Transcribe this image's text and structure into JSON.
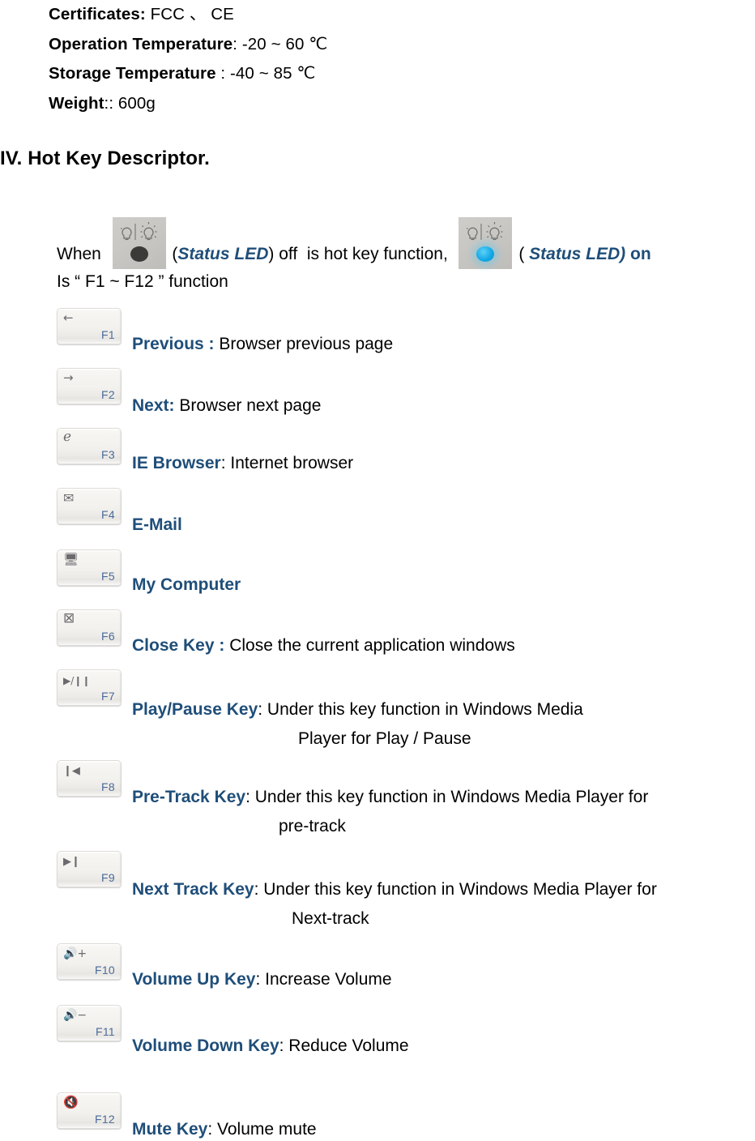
{
  "specs": [
    {
      "label": "Certificates:",
      "value": "  FCC  、  CE"
    },
    {
      "label": "Operation Temperature",
      "value": ": -20 ~ 60 ℃"
    },
    {
      "label": "Storage Temperature",
      "value": " : -40 ~ 85 ℃"
    },
    {
      "label": "Weight",
      "value": ":: 600g"
    }
  ],
  "section": {
    "heading": "IV. Hot Key Descriptor",
    "heading_tail": "."
  },
  "intro": {
    "when": "When",
    "led_off_paren_open": "(",
    "led_off_name": "Status LED",
    "led_off_paren_close": ") off",
    "mid": "is hot key function,",
    "led_on_paren_open": "(",
    "led_on_name": " Status LED)",
    "led_on_state": " on",
    "second_line": "Is  “ F1 ~ F12 ”  function",
    "led_off_icon": "status-led-off-icon",
    "led_on_icon": "status-led-on-icon"
  },
  "hotkeys": [
    {
      "key": "F1",
      "glyph": "←",
      "glyph_name": "arrow-left-icon",
      "label": "Previous :",
      "desc": " Browser previous page",
      "cont": null
    },
    {
      "key": "F2",
      "glyph": "→",
      "glyph_name": "arrow-right-icon",
      "label": "Next:",
      "desc": " Browser next page",
      "cont": null
    },
    {
      "key": "F3",
      "glyph": "ℯ",
      "glyph_name": "internet-explorer-icon",
      "label": "IE Browser",
      "desc": ": Internet browser",
      "cont": null
    },
    {
      "key": "F4",
      "glyph": "✉",
      "glyph_name": "envelope-icon",
      "label": "E-Mail",
      "desc": "",
      "cont": null
    },
    {
      "key": "F5",
      "glyph": "🖥",
      "glyph_name": "monitor-icon",
      "label": "My Computer",
      "desc": "",
      "cont": null
    },
    {
      "key": "F6",
      "glyph": "⊠",
      "glyph_name": "close-window-icon",
      "label": "Close Key :",
      "desc": " Close the current application windows",
      "cont": null
    },
    {
      "key": "F7",
      "glyph": "▶/❙❙",
      "glyph_name": "play-pause-icon",
      "label": "Play/Pause Key",
      "desc": ": Under this key function in Windows Media",
      "cont": "Player for Play / Pause"
    },
    {
      "key": "F8",
      "glyph": "❙◀",
      "glyph_name": "previous-track-icon",
      "label": "Pre-Track Key",
      "desc": ": Under this key function in Windows Media Player for",
      "cont": "pre-track"
    },
    {
      "key": "F9",
      "glyph": "▶❙",
      "glyph_name": "next-track-icon",
      "label": "Next Track Key",
      "desc": ": Under this key function in Windows Media Player for",
      "cont": "Next-track"
    },
    {
      "key": "F10",
      "glyph": "🔊+",
      "glyph_name": "volume-up-icon",
      "label": "Volume Up Key",
      "desc": ": Increase Volume",
      "cont": null
    },
    {
      "key": "F11",
      "glyph": "🔊−",
      "glyph_name": "volume-down-icon",
      "label": "Volume Down Key",
      "desc": ": Reduce Volume",
      "cont": null
    },
    {
      "key": "F12",
      "glyph": "🔇",
      "glyph_name": "mute-icon",
      "label": "Mute Key",
      "desc": ": Volume mute",
      "cont": null
    }
  ],
  "colors": {
    "accent_blue": "#1F4E79",
    "key_label_blue": "#4A6A99",
    "text_black": "#000000"
  }
}
